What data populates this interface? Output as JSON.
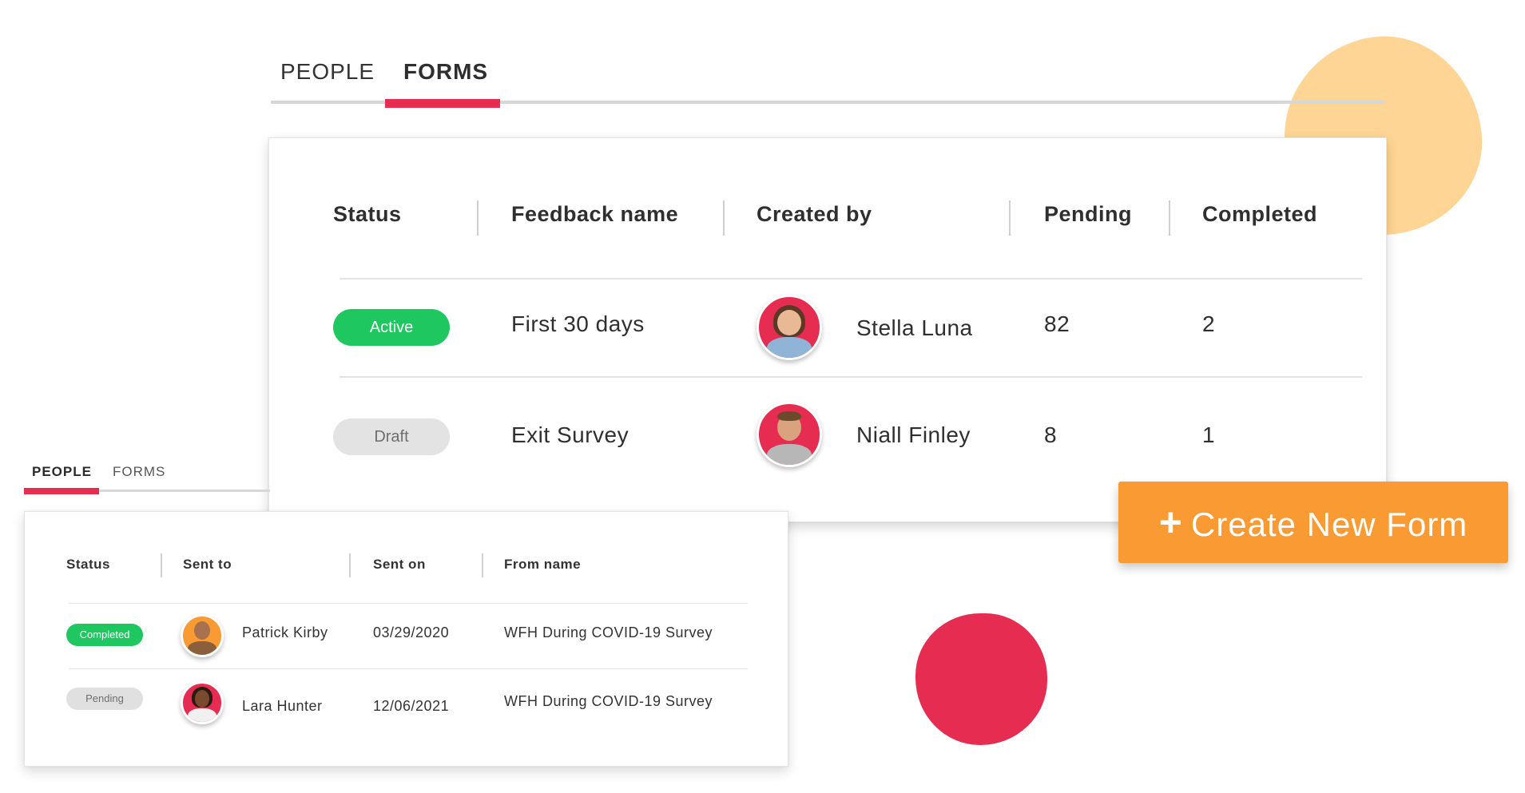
{
  "colors": {
    "accent": "#e62c50",
    "active_green": "#1ec760",
    "draft_gray": "#e3e3e3",
    "create_button": "#f99a32",
    "blob_orange": "#fed594",
    "blob_red": "#e62c50"
  },
  "forms_view": {
    "tabs": [
      {
        "label": "PEOPLE",
        "active": false
      },
      {
        "label": "FORMS",
        "active": true
      }
    ],
    "columns": [
      "Status",
      "Feedback name",
      "Created by",
      "Pending",
      "Completed"
    ],
    "rows": [
      {
        "status": "Active",
        "name": "First 30 days",
        "created_by": "Stella Luna",
        "avatar_icon": "avatar-stella-luna",
        "pending": "82",
        "completed": "2"
      },
      {
        "status": "Draft",
        "name": "Exit Survey",
        "created_by": "Niall Finley",
        "avatar_icon": "avatar-niall-finley",
        "pending": "8",
        "completed": "1"
      }
    ]
  },
  "create_button": {
    "icon": "plus-icon",
    "plus": "+",
    "label": "Create New Form"
  },
  "people_view": {
    "tabs": [
      {
        "label": "PEOPLE",
        "active": true
      },
      {
        "label": "FORMS",
        "active": false
      }
    ],
    "columns": [
      "Status",
      "Sent to",
      "Sent on",
      "From name"
    ],
    "rows": [
      {
        "status": "Completed",
        "sent_to": "Patrick Kirby",
        "avatar_icon": "avatar-patrick-kirby",
        "sent_on": "03/29/2020",
        "from_name": "WFH During COVID-19 Survey"
      },
      {
        "status": "Pending",
        "sent_to": "Lara Hunter",
        "avatar_icon": "avatar-lara-hunter",
        "sent_on": "12/06/2021",
        "from_name": "WFH During COVID-19 Survey"
      }
    ]
  }
}
